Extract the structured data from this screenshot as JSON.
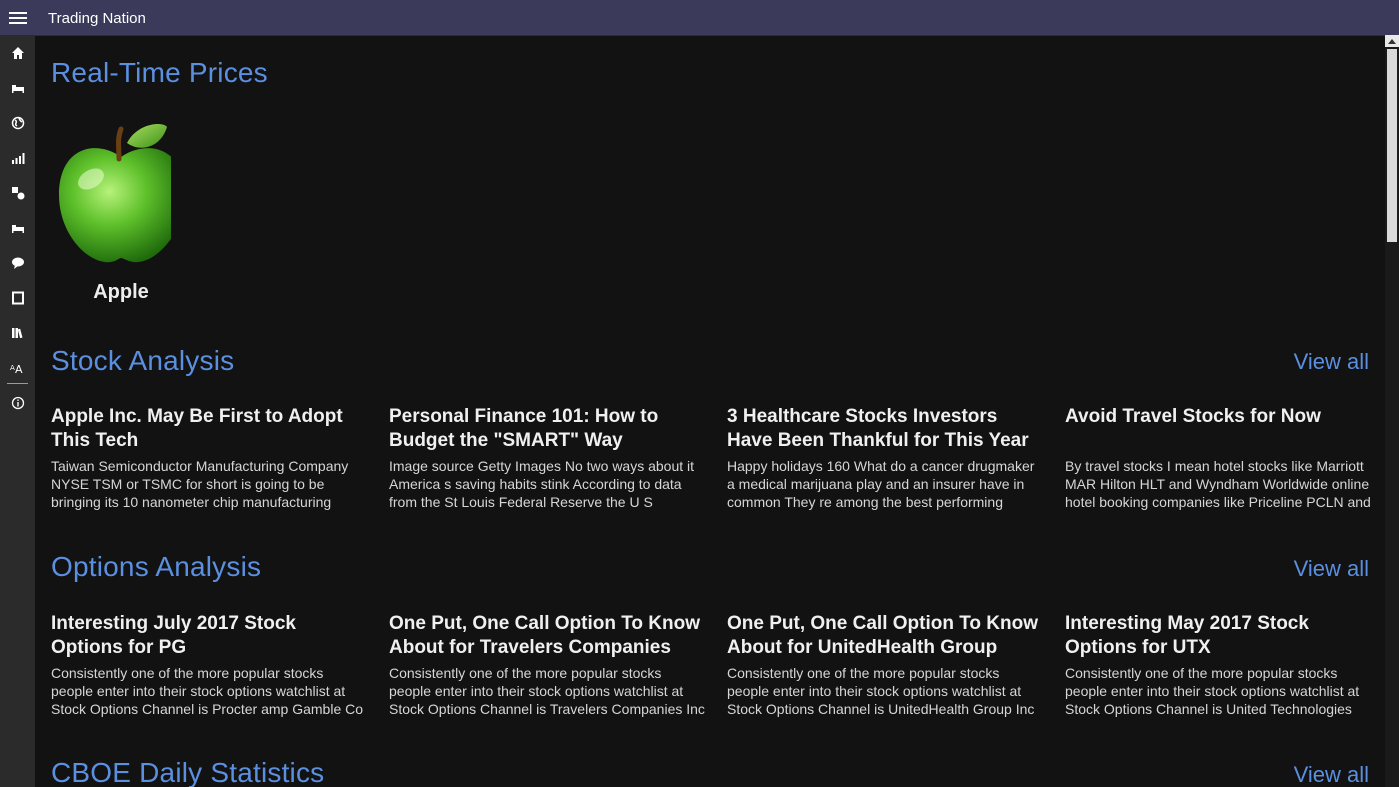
{
  "app": {
    "title": "Trading Nation"
  },
  "colors": {
    "accent": "#5b8fe0",
    "titlebar": "#3b3a5a",
    "sidebar": "#2b2b2b",
    "background": "#121212"
  },
  "sidebar": {
    "items": [
      {
        "icon": "home-icon"
      },
      {
        "icon": "bed-icon"
      },
      {
        "icon": "globe-icon"
      },
      {
        "icon": "bar-chart-icon"
      },
      {
        "icon": "shapes-icon"
      },
      {
        "icon": "bed-icon"
      },
      {
        "icon": "speech-bubble-icon"
      },
      {
        "icon": "tablet-icon"
      },
      {
        "icon": "library-icon"
      },
      {
        "icon": "font-size-icon"
      },
      {
        "icon": "info-icon"
      }
    ]
  },
  "realtime": {
    "title": "Real-Time Prices",
    "tiles": [
      {
        "label": "Apple"
      }
    ]
  },
  "stock": {
    "title": "Stock Analysis",
    "view_all": "View all",
    "cards": [
      {
        "headline": "Apple Inc. May Be First to Adopt This Tech",
        "summary": "Taiwan Semiconductor Manufacturing Company NYSE TSM or TSMC for short is going to be bringing its 10 nanometer chip manufacturing"
      },
      {
        "headline": "Personal Finance 101: How to Budget the \"SMART\" Way",
        "summary": "Image source Getty Images No two ways about it America s saving habits stink According to data from the St Louis Federal Reserve the U S personal"
      },
      {
        "headline": "3 Healthcare Stocks Investors Have Been Thankful for This Year",
        "summary": "Happy holidays 160 What do a cancer drugmaker a medical marijuana play and an insurer have in common They re among the best performing"
      },
      {
        "headline": "Avoid Travel Stocks for Now",
        "summary": "By travel stocks I mean hotel stocks like Marriott MAR Hilton HLT and Wyndham Worldwide online hotel booking companies like Priceline PCLN and"
      }
    ]
  },
  "options": {
    "title": "Options Analysis",
    "view_all": "View all",
    "cards": [
      {
        "headline": "Interesting July 2017 Stock Options for PG",
        "summary": "Consistently one of the more popular stocks people enter into their stock options watchlist at Stock Options Channel is Procter amp Gamble Co"
      },
      {
        "headline": "One Put, One Call Option To Know About for Travelers Companies",
        "summary": "Consistently one of the more popular stocks people enter into their stock options watchlist at Stock Options Channel is Travelers Companies Inc"
      },
      {
        "headline": "One Put, One Call Option To Know About for UnitedHealth Group",
        "summary": "Consistently one of the more popular stocks people enter into their stock options watchlist at Stock Options Channel is UnitedHealth Group Inc"
      },
      {
        "headline": "Interesting May 2017 Stock Options for UTX",
        "summary": "Consistently one of the more popular stocks people enter into their stock options watchlist at Stock Options Channel is United Technologies Corp"
      }
    ]
  },
  "cboe": {
    "title": "CBOE Daily Statistics",
    "view_all": "View all"
  }
}
